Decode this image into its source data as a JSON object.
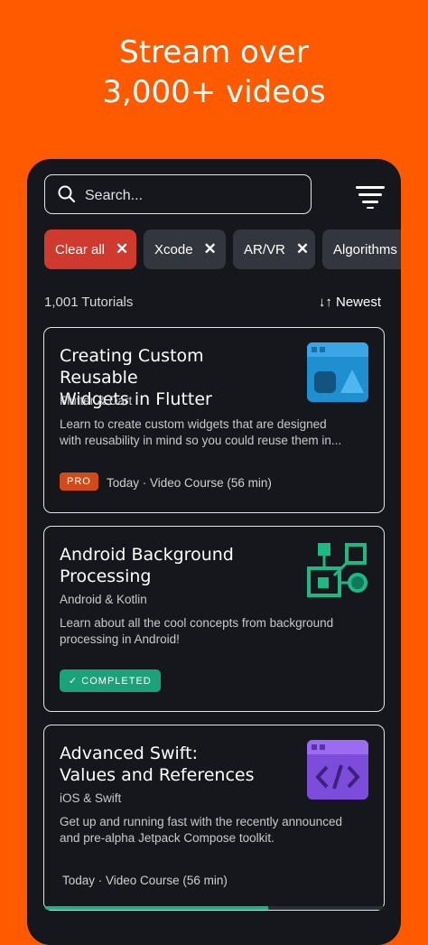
{
  "headline": {
    "line1": "Stream over",
    "line2": "3,000+ videos"
  },
  "search": {
    "placeholder": "Search..."
  },
  "chips": [
    {
      "label": "Clear all",
      "close": "✕"
    },
    {
      "label": "Xcode",
      "close": "✕"
    },
    {
      "label": "AR/VR",
      "close": "✕"
    },
    {
      "label": "Algorithms"
    }
  ],
  "results": {
    "count": "1,001 Tutorials",
    "sort": "↓↑ Newest"
  },
  "cards": [
    {
      "title_line1": "Creating Custom Reusable",
      "title_line2": "Widgets in Flutter",
      "category": "Flutter & Dart",
      "desc_line1": "Learn to create custom widgets that are designed",
      "desc_line2": "with reusability in mind so you could reuse them in...",
      "badge": "PRO",
      "info": "Today · Video Course (56 min)"
    },
    {
      "title_line1": "Android Background",
      "title_line2": "Processing",
      "category": "Android & Kotlin",
      "desc_line1": "Learn about all the cool concepts from background",
      "desc_line2": "processing in Android!",
      "badge": "COMPLETED"
    },
    {
      "title_line1": "Advanced Swift:",
      "title_line2": "Values and References",
      "category": "iOS & Swift",
      "desc_line1": "Get up and running fast with the recently announced",
      "desc_line2": "and pre-alpha Jetpack Compose toolkit.",
      "info": "Today · Video Course (56 min)",
      "progress": 0.66
    }
  ],
  "colors": {
    "background": "#ff5a00",
    "panel": "#15171c",
    "chip_active": "#d0392e",
    "chip": "#33363c",
    "pro_badge": "#d24a18",
    "completed_badge": "#1aa37a"
  },
  "icons": [
    "search-icon",
    "filter-icon",
    "close-icon",
    "check-icon",
    "window-icon",
    "diagram-icon",
    "code-icon"
  ]
}
